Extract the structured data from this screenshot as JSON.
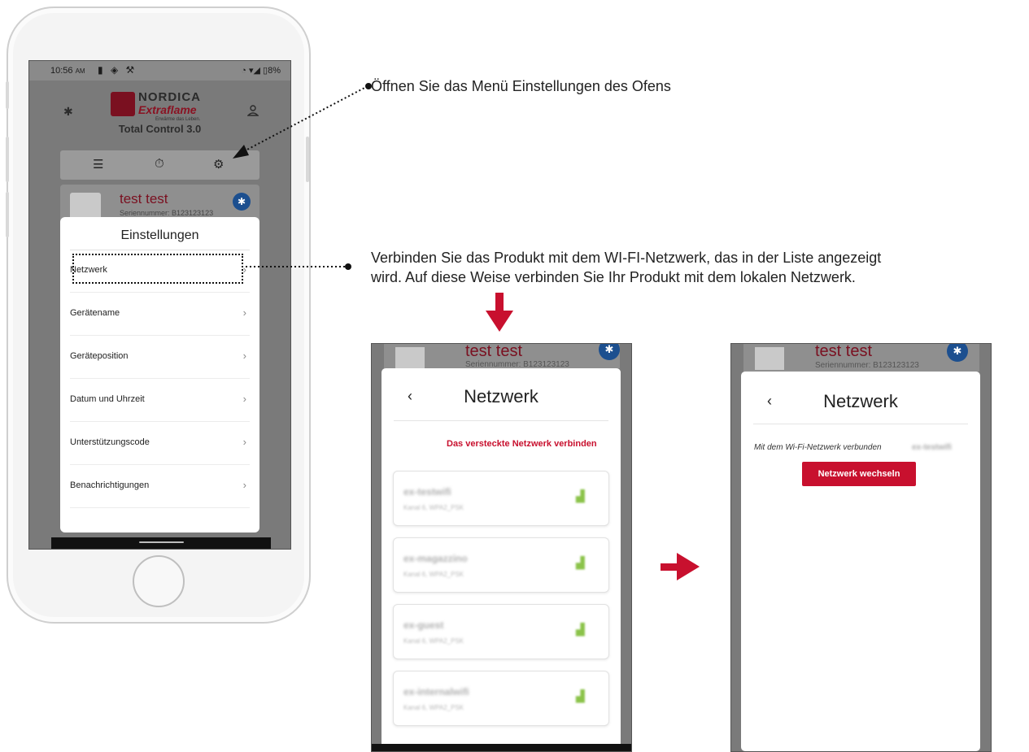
{
  "phone": {
    "status_time": "10:56",
    "status_time_suffix": "AM",
    "status_icons": "▮ ◈ ⚒",
    "status_right": "◔ ▾◢ ▯8%",
    "brand_name": "NORDICA",
    "brand_sub": "Extraflame",
    "brand_tagline": "Erwärme das Leben.",
    "app_title": "Total Control 3.0",
    "device_name": "test test",
    "device_serial": "Seriennummer: B123123123",
    "settings_title": "Einstellungen",
    "menu_items": [
      {
        "label": "Netzwerk"
      },
      {
        "label": "Gerätename"
      },
      {
        "label": "Geräteposition"
      },
      {
        "label": "Datum und Uhrzeit"
      },
      {
        "label": "Unterstützungscode"
      },
      {
        "label": "Benachrichtigungen"
      }
    ]
  },
  "annotations": {
    "open_settings": "Öffnen Sie das Menü Einstellungen des Ofens",
    "connect_line1": "Verbinden Sie das Produkt mit dem WI-FI-Netzwerk, das in der Liste angezeigt",
    "connect_line2": "wird. Auf diese Weise verbinden Sie Ihr Produkt mit dem lokalen Netzwerk."
  },
  "network_list_screen": {
    "device_name": "test test",
    "device_serial": "Seriennummer: B123123123",
    "title": "Netzwerk",
    "back": "‹",
    "hidden_network_link": "Das versteckte Netzwerk verbinden",
    "networks": [
      {
        "ssid": "ex-testwifi",
        "details": "Kanal 6, WPA2_PSK"
      },
      {
        "ssid": "ex-magazzino",
        "details": "Kanal 6, WPA2_PSK"
      },
      {
        "ssid": "ex-guest",
        "details": "Kanal 6, WPA2_PSK"
      },
      {
        "ssid": "ex-internalwifi",
        "details": "Kanal 6, WPA2_PSK"
      }
    ]
  },
  "connected_screen": {
    "device_name": "test test",
    "device_serial": "Seriennummer: B123123123",
    "title": "Netzwerk",
    "back": "‹",
    "connected_label": "Mit dem Wi-Fi-Netzwerk verbunden",
    "connected_ssid": "ex-testwifi",
    "switch_button": "Netzwerk wechseln"
  },
  "colors": {
    "accent_red": "#c8102e",
    "brand_dark_red": "#7a1020",
    "bluetooth_blue": "#1c4f8f",
    "signal_green": "#8bc34a"
  },
  "icons": {
    "bluetooth": "bluetooth-icon",
    "user": "user-icon",
    "list": "list-icon",
    "timer": "timer-icon",
    "settings": "gear-icon",
    "chevron": "chevron-right-icon",
    "wifi_signal": "wifi-signal-icon"
  }
}
